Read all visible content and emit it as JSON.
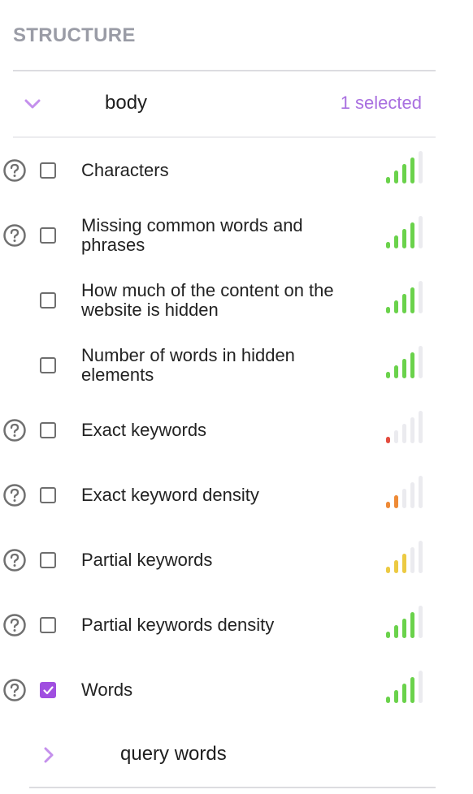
{
  "section": {
    "title": "STRUCTURE"
  },
  "group": {
    "label": "body",
    "selected_label": "1 selected",
    "expanded": true,
    "icon": "chevron-down-icon"
  },
  "colors": {
    "accent": "#a970e0",
    "checkbox_checked": "#a04fe0",
    "bar_empty": "#ebebef",
    "green": "#6ad24b",
    "red": "#e34c3e",
    "orange": "#ee8a36",
    "yellow": "#ecca42"
  },
  "bar_max": 5,
  "items": [
    {
      "label": "Characters",
      "help": true,
      "checked": false,
      "strength": 4,
      "color": "green"
    },
    {
      "label": "Missing common words and phrases",
      "help": true,
      "checked": false,
      "strength": 4,
      "color": "green"
    },
    {
      "label": "How much of the content on the website is hidden",
      "help": false,
      "checked": false,
      "strength": 4,
      "color": "green"
    },
    {
      "label": "Number of words in hidden elements",
      "help": false,
      "checked": false,
      "strength": 4,
      "color": "green"
    },
    {
      "label": "Exact keywords",
      "help": true,
      "checked": false,
      "strength": 1,
      "color": "red"
    },
    {
      "label": "Exact keyword density",
      "help": true,
      "checked": false,
      "strength": 2,
      "color": "orange"
    },
    {
      "label": "Partial keywords",
      "help": true,
      "checked": false,
      "strength": 3,
      "color": "yellow"
    },
    {
      "label": "Partial keywords density",
      "help": true,
      "checked": false,
      "strength": 4,
      "color": "green"
    },
    {
      "label": "Words",
      "help": true,
      "checked": true,
      "strength": 4,
      "color": "green"
    }
  ],
  "subgroup": {
    "label": "query words",
    "expanded": false,
    "icon": "chevron-right-icon"
  }
}
